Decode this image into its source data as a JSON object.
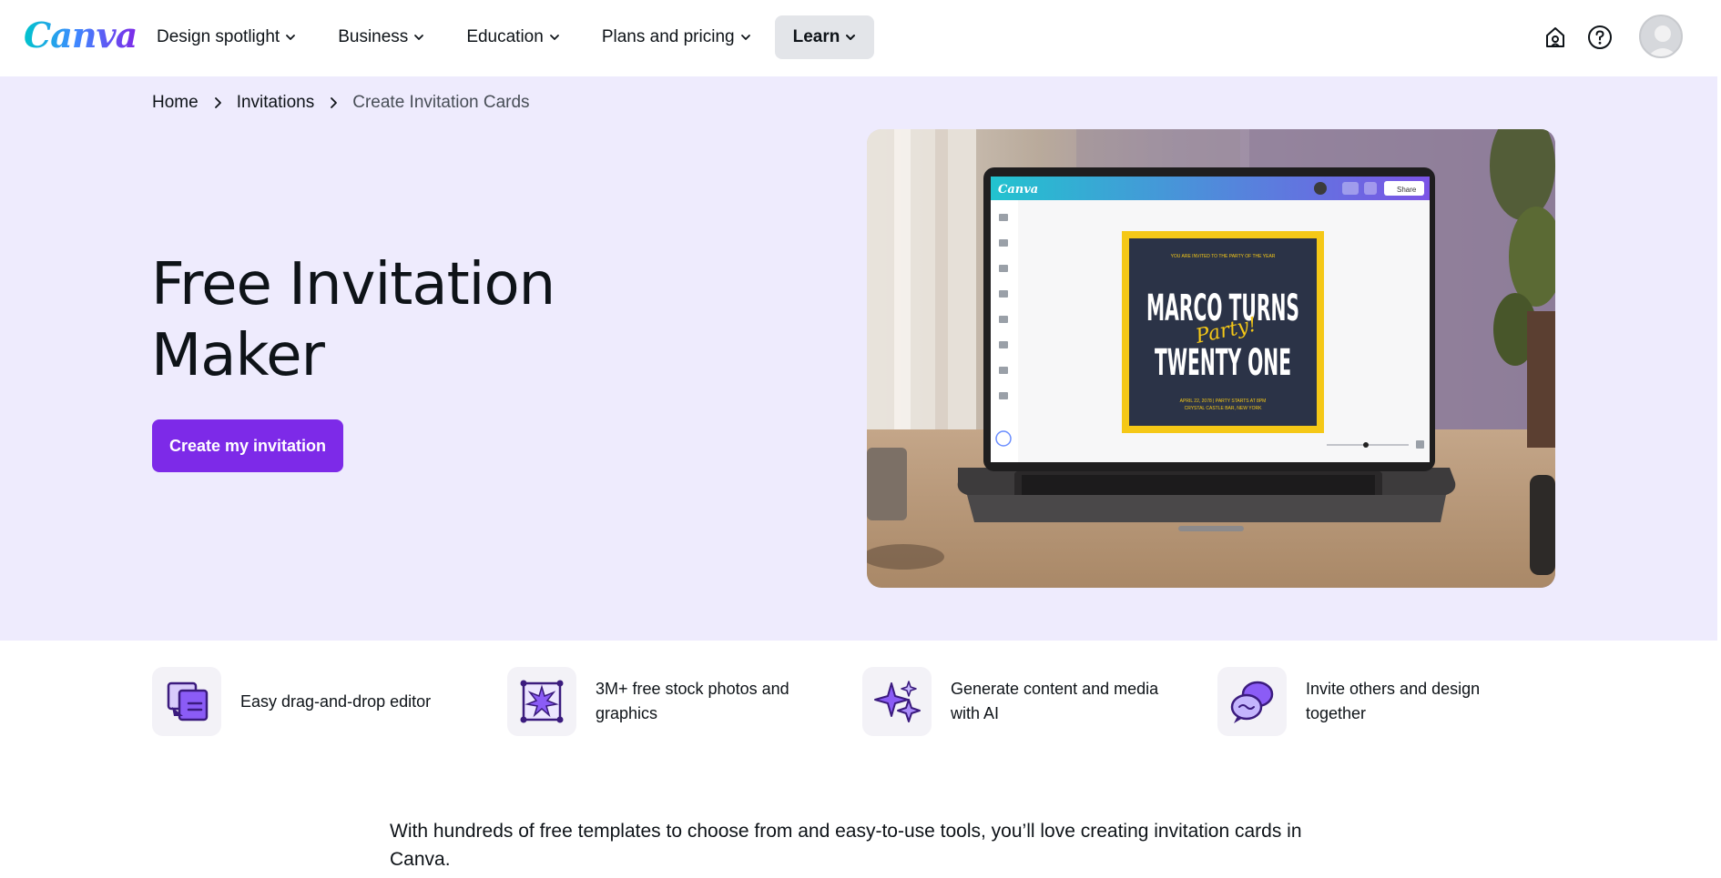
{
  "header": {
    "logo_text": "Canva",
    "nav": [
      {
        "label": "Design spotlight",
        "active": false
      },
      {
        "label": "Business",
        "active": false
      },
      {
        "label": "Education",
        "active": false
      },
      {
        "label": "Plans and pricing",
        "active": false
      },
      {
        "label": "Learn",
        "active": true
      }
    ],
    "icons": [
      "home-notification-icon",
      "help-icon",
      "avatar"
    ]
  },
  "breadcrumb": [
    "Home",
    "Invitations",
    "Create Invitation Cards"
  ],
  "hero": {
    "title": "Free Invitation Maker",
    "cta_label": "Create my invitation",
    "image": {
      "app_logo": "Canva",
      "share_label": "Share",
      "card_small_top": "YOU ARE INVITED TO THE PARTY OF THE YEAR",
      "card_line1": "MARCO TURNS",
      "card_script": "Party!",
      "card_line2": "TWENTY ONE",
      "card_small_bottom1": "APRIL 22, 2078 | PARTY STARTS AT 8PM",
      "card_small_bottom2": "CRYSTAL CASTLE BAR, NEW YORK"
    }
  },
  "features": [
    {
      "icon": "drag-drop-editor-icon",
      "text": "Easy drag-and-drop editor"
    },
    {
      "icon": "stock-photos-icon",
      "text": "3M+ free stock photos and graphics"
    },
    {
      "icon": "ai-sparkle-icon",
      "text": "Generate content and media with AI"
    },
    {
      "icon": "collaborate-chat-icon",
      "text": "Invite others and design together"
    }
  ],
  "intro_text": "With hundreds of free templates to choose from and easy-to-use tools, you’ll love creating invitation cards in Canva.",
  "colors": {
    "brand_purple": "#7d2ae8",
    "hero_bg": "#eeebfd",
    "active_nav_bg": "#e3e5e9",
    "card_navy": "#2b3347",
    "card_yellow": "#f5c817"
  }
}
